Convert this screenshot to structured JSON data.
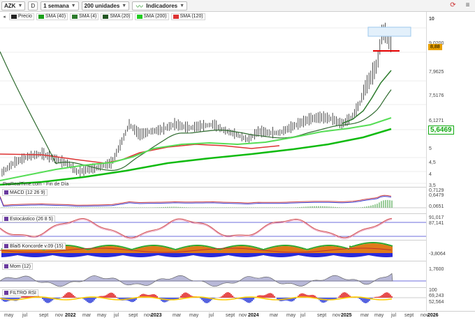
{
  "toolbar": {
    "symbol": "AZK",
    "d_label": "D",
    "period": "1 semana",
    "units": "200 unidades",
    "indicators": "Indicadores"
  },
  "legend": [
    {
      "label": "Precio",
      "color": "#222222"
    },
    {
      "label": "SMA (40)",
      "color": "#1aa01a"
    },
    {
      "label": "SMA (4)",
      "color": "#2b7a2b"
    },
    {
      "label": "SMA (20)",
      "color": "#225522"
    },
    {
      "label": "SMA (200)",
      "color": "#22cc22"
    },
    {
      "label": "SMA (120)",
      "color": "#dd3333"
    }
  ],
  "watermark": "ProRealTime.com - Fin de Día",
  "price_axis": {
    "ticks": [
      "10",
      "9,0200",
      "7,9625",
      "7,5176",
      "6,1271",
      "5",
      "4,5",
      "4",
      "3,5"
    ],
    "tags": [
      {
        "label": "8,88",
        "color": "#e8a000"
      },
      {
        "label": "5,6469",
        "color": "#11aa11"
      }
    ]
  },
  "panels": [
    {
      "label": "MACD (12 26 9)",
      "ticks": [
        "0,7129",
        "0,6479",
        "0,0651"
      ]
    },
    {
      "label": "Estocástico (26 8 5)",
      "ticks": [
        "91,017",
        "87,141"
      ]
    },
    {
      "label": "Blai5 Koncorde v.09 (15)",
      "ticks": [
        "-3,8064"
      ]
    },
    {
      "label": "Mom (12)",
      "ticks": [
        "1,7600"
      ]
    },
    {
      "label": "FILTRO RSI",
      "ticks": [
        "100",
        "69,243",
        "52,564"
      ]
    }
  ],
  "x_axis": {
    "labels": [
      "may",
      "jul",
      "sept",
      "nov",
      "2022",
      "mar",
      "may",
      "jul",
      "sept",
      "nov",
      "2023",
      "mar",
      "may",
      "jul",
      "sept",
      "nov",
      "2024",
      "mar",
      "may",
      "jul",
      "sept",
      "nov",
      "2025",
      "mar",
      "may",
      "jul",
      "sept",
      "nov",
      "2026"
    ],
    "bold": [
      "2022",
      "2023",
      "2024",
      "2025",
      "2026"
    ]
  },
  "colors": {
    "price": "#222222",
    "sma120": "#dd3333",
    "sma200": "#11bb11",
    "sma40": "#55dd55",
    "sma20": "#336633",
    "resistance_box": "#9cc8ee",
    "support_line": "#e60000"
  }
}
